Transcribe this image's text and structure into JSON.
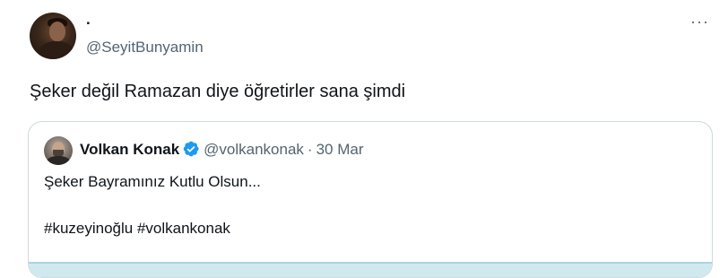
{
  "tweet": {
    "display_name": ".",
    "handle": "@SeyitBunyamin",
    "text": "Şeker değil Ramazan diye öğretirler sana şimdi",
    "more_label": "···"
  },
  "quote": {
    "name": "Volkan Konak",
    "handle": "@volkankonak",
    "separator": "·",
    "date": "30 Mar",
    "line1": "Şeker Bayramınız Kutlu Olsun...",
    "line2": "#kuzeyinoğlu #volkankonak",
    "verified_icon": "verified-badge-icon"
  },
  "colors": {
    "text_primary": "#0f1419",
    "text_secondary": "#536471",
    "verified_blue": "#1d9bf0",
    "border": "#cfd9de"
  }
}
